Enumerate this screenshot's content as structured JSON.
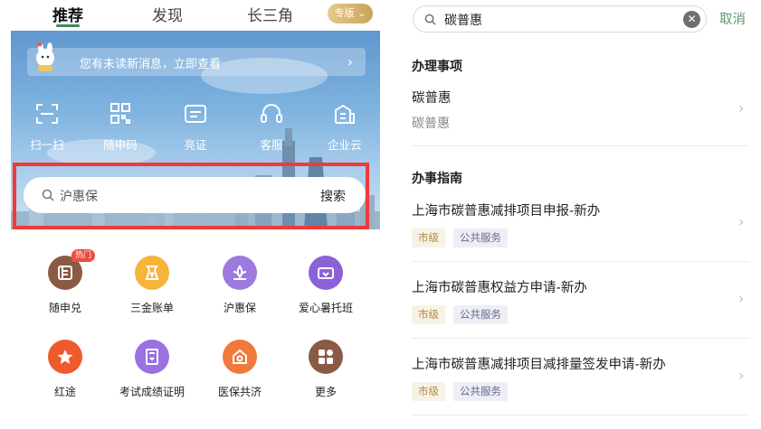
{
  "left": {
    "tabs": [
      {
        "label": "推荐",
        "active": true
      },
      {
        "label": "发现",
        "active": false
      },
      {
        "label": "长三角",
        "active": false
      }
    ],
    "edition": "专版",
    "notice": "您有未读新消息，立即查看",
    "quick_actions": [
      {
        "label": "扫一扫",
        "icon": "scan-icon"
      },
      {
        "label": "随申码",
        "icon": "qr-code-icon"
      },
      {
        "label": "亮证",
        "icon": "id-card-icon"
      },
      {
        "label": "客服",
        "icon": "headset-icon"
      },
      {
        "label": "企业云",
        "icon": "building-icon"
      }
    ],
    "search": {
      "value": "沪惠保",
      "button": "搜索"
    },
    "services": [
      {
        "label": "随申兑",
        "icon": "redeem-icon",
        "color": "#8a5a44",
        "badge": "热门"
      },
      {
        "label": "三金账单",
        "icon": "fund-bill-icon",
        "color": "#f5b43a"
      },
      {
        "label": "沪惠保",
        "icon": "insurance-lotus-icon",
        "color": "#9b7be0"
      },
      {
        "label": "爱心暑托班",
        "icon": "summer-class-icon",
        "color": "#8b62d6"
      },
      {
        "label": "红途",
        "icon": "red-star-icon",
        "color": "#ef5a2c"
      },
      {
        "label": "考试成绩证明",
        "icon": "exam-certificate-icon",
        "color": "#9a72e2"
      },
      {
        "label": "医保共济",
        "icon": "medical-insurance-icon",
        "color": "#f07a3c"
      },
      {
        "label": "更多",
        "icon": "more-grid-icon",
        "color": "#8a5a44"
      }
    ]
  },
  "right": {
    "search": {
      "value": "碳普惠"
    },
    "cancel": "取消",
    "section_matters": "办理事项",
    "matter": {
      "title": "碳普惠",
      "subtitle": "碳普惠"
    },
    "section_guide": "办事指南",
    "guides": [
      {
        "title": "上海市碳普惠减排项目申报-新办",
        "tags": [
          "市级",
          "公共服务"
        ]
      },
      {
        "title": "上海市碳普惠权益方申请-新办",
        "tags": [
          "市级",
          "公共服务"
        ]
      },
      {
        "title": "上海市碳普惠减排项目减排量签发申请-新办",
        "tags": [
          "市级",
          "公共服务"
        ]
      }
    ]
  },
  "colors": {
    "accent_green": "#3d8a5c",
    "highlight_red": "#f03a3a",
    "cancel_green": "#5a9a6e"
  }
}
